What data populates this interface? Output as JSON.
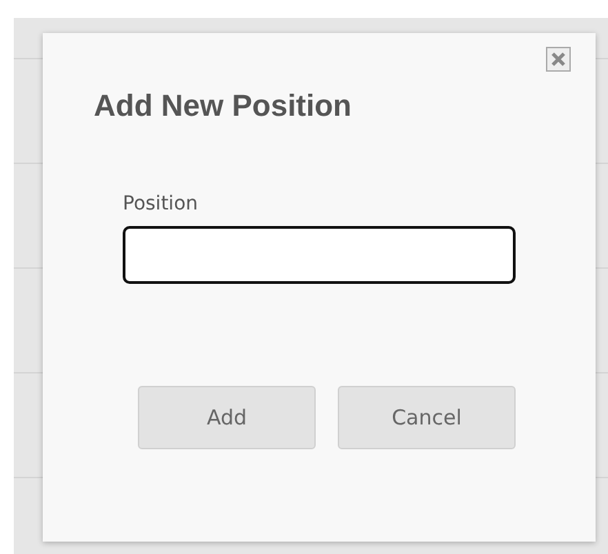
{
  "dialog": {
    "title": "Add New Position",
    "field": {
      "label": "Position",
      "focused": true
    },
    "buttons": [
      "Add",
      "Cancel"
    ]
  }
}
